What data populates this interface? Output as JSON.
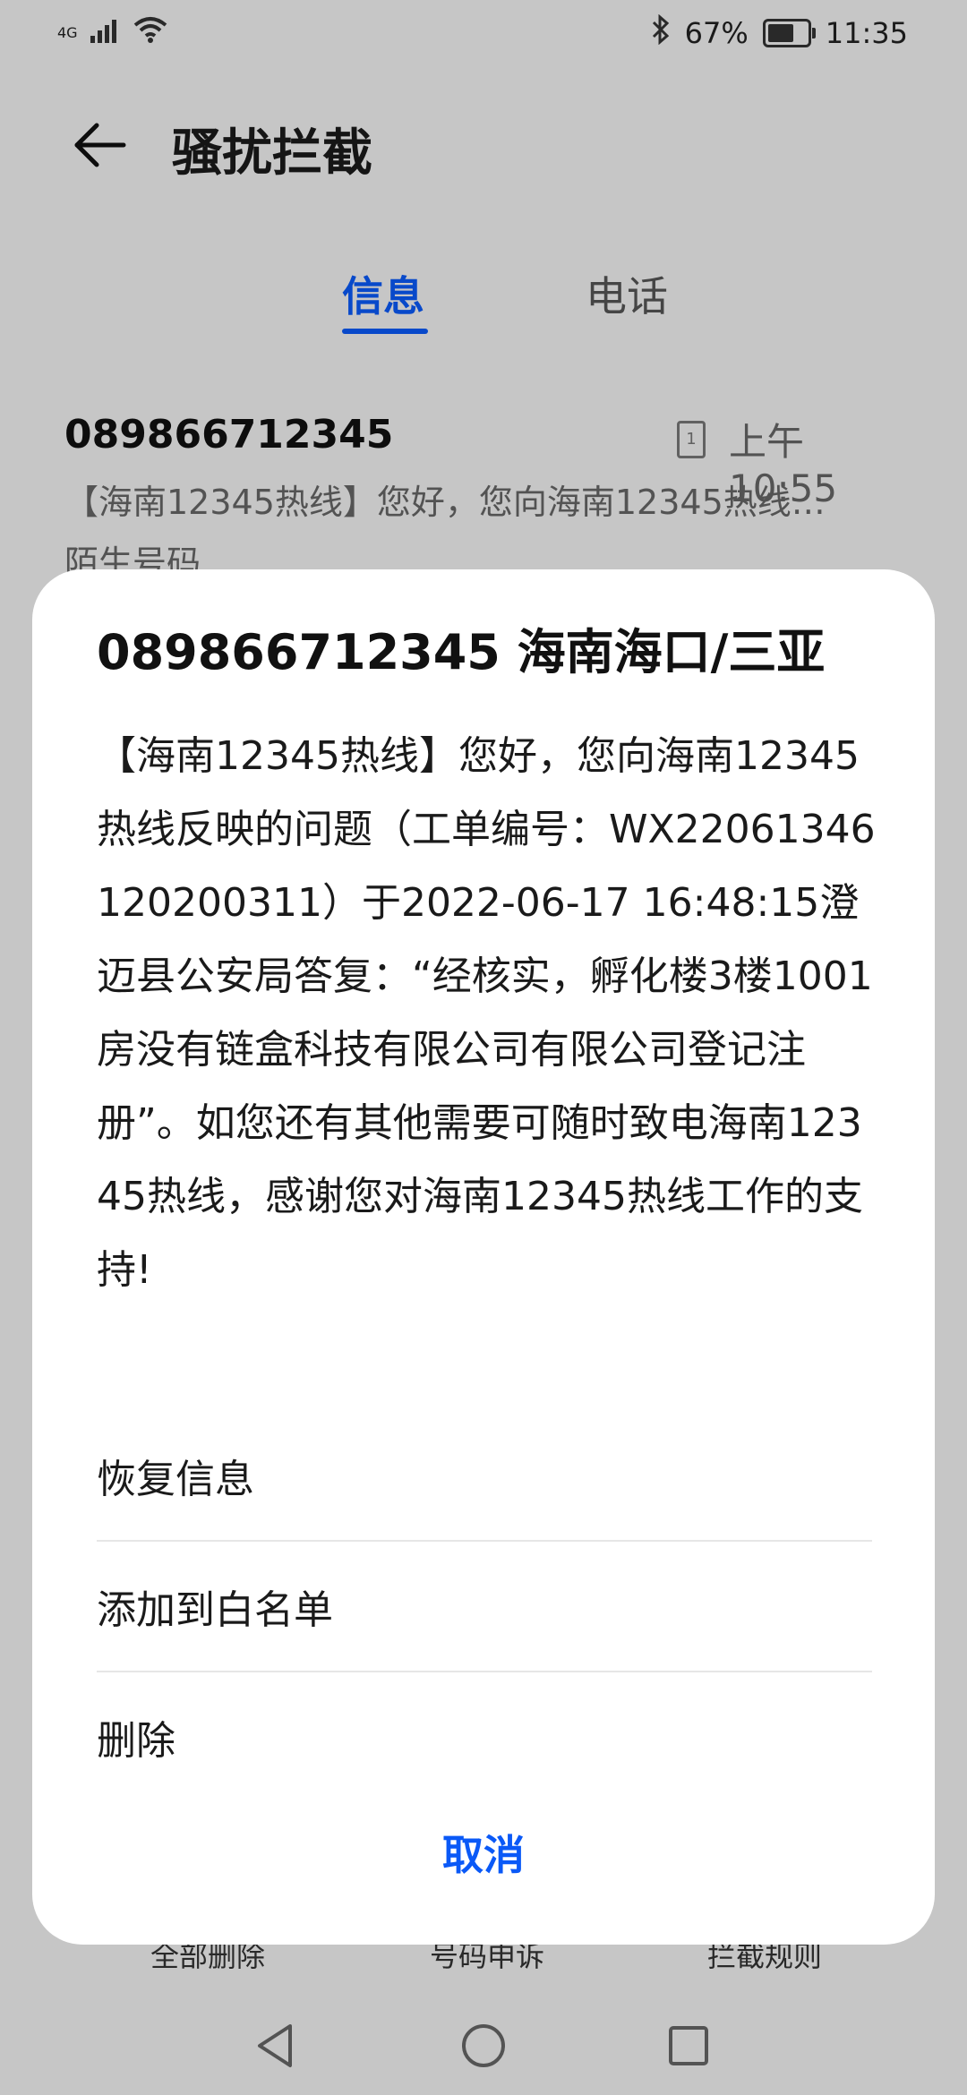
{
  "status_bar": {
    "network": "4G",
    "battery_percent": "67%",
    "battery_fraction": 0.67,
    "time": "11:35",
    "icons": [
      "signal-icon",
      "wifi-icon",
      "bluetooth-icon",
      "battery-icon"
    ]
  },
  "header": {
    "title": "骚扰拦截",
    "back_icon": "back-arrow-icon"
  },
  "tabs": [
    {
      "label": "信息",
      "active": true
    },
    {
      "label": "电话",
      "active": false
    }
  ],
  "message_item": {
    "number": "089866712345",
    "sim_label": "1",
    "time": "上午10:55",
    "preview": "【海南12345热线】您好，您向海南12345热线…",
    "tag": "陌生号码"
  },
  "bottom_actions": {
    "delete_all": "全部删除",
    "appeal": "号码申诉",
    "rules": "拦截规则"
  },
  "dialog": {
    "title": "089866712345 海南海口/三亚",
    "body": "【海南12345热线】您好，您向海南12345热线反映的问题（工单编号：WX22061346120200311）于2022-06-17 16:48:15澄迈县公安局答复：“经核实，孵化楼3楼1001房没有链盒科技有限公司有限公司登记注册”。如您还有其他需要可随时致电海南12345热线，感谢您对海南12345热线工作的支持!",
    "menu": {
      "restore": "恢复信息",
      "whitelist": "添加到白名单",
      "delete": "删除"
    },
    "cancel": "取消"
  },
  "colors": {
    "accent": "#0a59f7",
    "scrim": "rgba(0,0,0,0.18)"
  }
}
